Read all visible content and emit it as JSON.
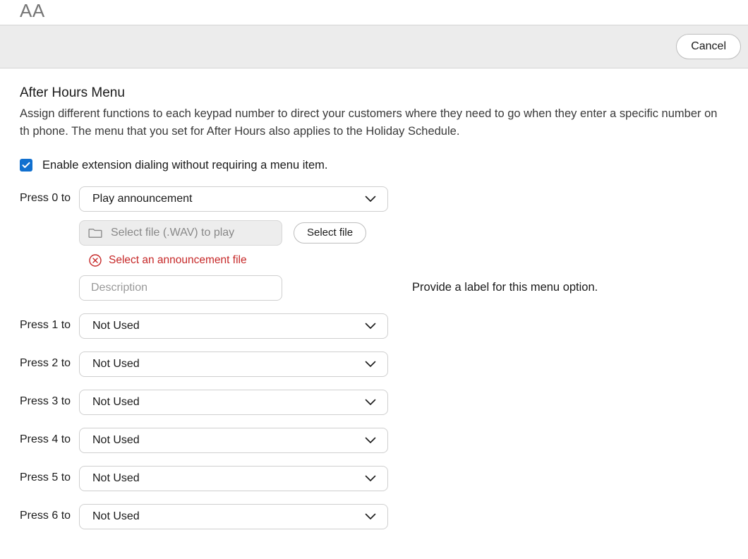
{
  "top_label": "AA",
  "header": {
    "cancel": "Cancel"
  },
  "section": {
    "title": "After Hours Menu",
    "description": "Assign different functions to each keypad number to direct your customers where they need to go when they enter a specific number on th phone. The menu that you set for After Hours also applies to the Holiday Schedule."
  },
  "enable_checkbox": {
    "checked": true,
    "label": "Enable extension dialing without requiring a menu item."
  },
  "press0": {
    "label": "Press 0 to",
    "action": "Play announcement",
    "file_placeholder": "Select file (.WAV) to play",
    "select_file_btn": "Select file",
    "error": "Select an announcement file",
    "desc_placeholder": "Description",
    "desc_hint": "Provide a label for this menu option."
  },
  "rows": [
    {
      "label": "Press 1 to",
      "value": "Not Used"
    },
    {
      "label": "Press 2 to",
      "value": "Not Used"
    },
    {
      "label": "Press 3 to",
      "value": "Not Used"
    },
    {
      "label": "Press 4 to",
      "value": "Not Used"
    },
    {
      "label": "Press 5 to",
      "value": "Not Used"
    },
    {
      "label": "Press 6 to",
      "value": "Not Used"
    }
  ]
}
